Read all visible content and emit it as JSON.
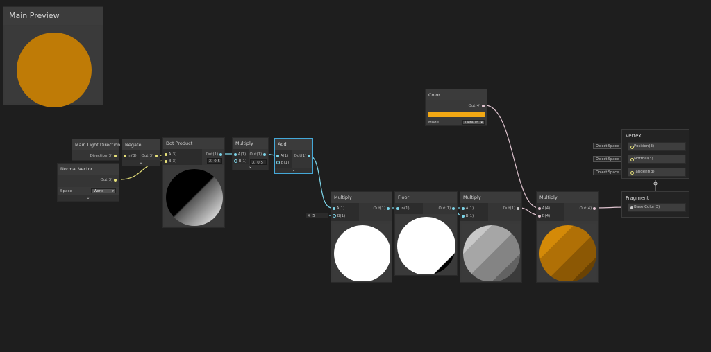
{
  "main_preview": {
    "title": "Main Preview",
    "color": "#bf7b06"
  },
  "nodes": {
    "main_light": {
      "title": "Main Light Direction",
      "out": "Direction(3)"
    },
    "negate": {
      "title": "Negate",
      "in": "In(3)",
      "out": "Out(3)"
    },
    "normal_vector": {
      "title": "Normal Vector",
      "out": "Out(3)",
      "space_label": "Space",
      "space_value": "World"
    },
    "dot_product": {
      "title": "Dot Product",
      "in_a": "A(3)",
      "in_b": "B(3)",
      "out": "Out(1)",
      "x_label": "X",
      "x_value": "0.5"
    },
    "multiply1": {
      "title": "Multiply",
      "in_a": "A(1)",
      "in_b": "B(1)",
      "out": "Out(1)",
      "x_label": "X",
      "x_value": "0.5"
    },
    "add": {
      "title": "Add",
      "in_a": "A(1)",
      "in_b": "B(1)",
      "out": "Out(1)"
    },
    "color": {
      "title": "Color",
      "out": "Out(4)",
      "swatch": "#f2a814",
      "mode_label": "Mode",
      "mode_value": "Default"
    },
    "multiply2": {
      "title": "Multiply",
      "in_a": "A(1)",
      "in_b": "B(1)",
      "out": "Out(1)",
      "x_label": "X",
      "x_value": "5"
    },
    "floor": {
      "title": "Floor",
      "in": "In(1)",
      "out": "Out(1)"
    },
    "multiply3": {
      "title": "Multiply",
      "in_a": "A(1)",
      "in_b": "B(1)",
      "out": "Out(1)"
    },
    "multiply4": {
      "title": "Multiply",
      "in_a": "A(4)",
      "in_b": "B(4)",
      "out": "Out(4)"
    }
  },
  "vertex": {
    "title": "Vertex",
    "slots": [
      {
        "tag": "Object Space",
        "label": "Position(3)"
      },
      {
        "tag": "Object Space",
        "label": "Normal(3)"
      },
      {
        "tag": "Object Space",
        "label": "Tangent(3)"
      }
    ]
  },
  "fragment": {
    "title": "Fragment",
    "slots": [
      {
        "label": "Base Color(3)"
      }
    ]
  },
  "colors": {
    "wire_vec3": "#e8e27a",
    "wire_float": "#7cd4e8",
    "wire_vec4": "#e0c4d0",
    "selection": "#44a8d8",
    "orange": "#bf7b06"
  },
  "icons": {
    "expand": "chevron-down-icon"
  }
}
